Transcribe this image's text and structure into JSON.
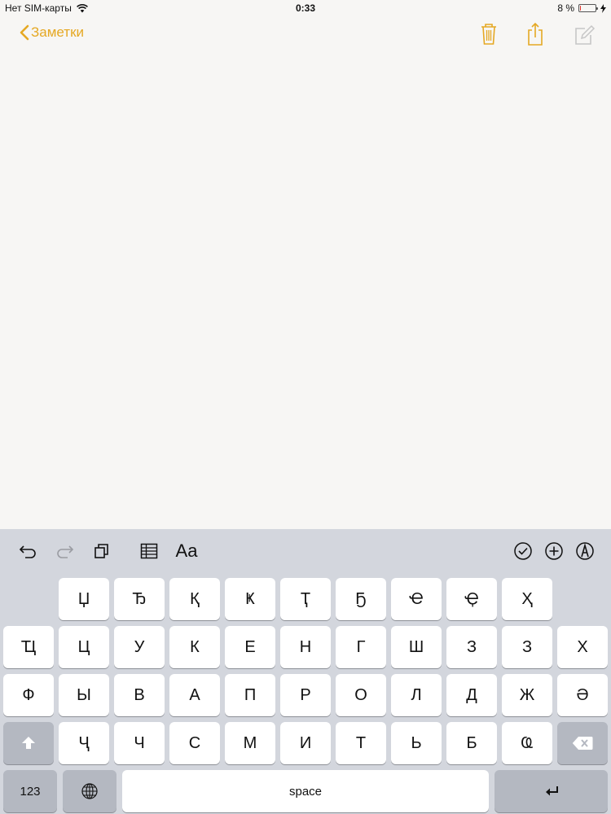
{
  "status_bar": {
    "carrier": "Нет SIM-карты",
    "time": "0:33",
    "battery_text": "8 %",
    "battery_level": 0.08
  },
  "nav": {
    "back_label": "Заметки",
    "accent_color": "#e5a823",
    "icons": [
      "trash-icon",
      "share-icon",
      "compose-icon"
    ]
  },
  "toolbar": {
    "format_label": "Aa",
    "icons": [
      "undo-icon",
      "redo-icon",
      "paste-icon",
      "table-icon",
      "checklist-icon",
      "add-icon",
      "markup-icon"
    ]
  },
  "keyboard": {
    "row1": [
      "Џ",
      "Ђ",
      "Қ",
      "Ҝ",
      "Ҭ",
      "Ҕ",
      "Ҽ",
      "Ҿ",
      "Ҳ"
    ],
    "row2": [
      "Ҵ",
      "Ц",
      "У",
      "К",
      "Е",
      "Н",
      "Г",
      "Ш",
      "З",
      "З",
      "Х"
    ],
    "row3": [
      "Ф",
      "Ы",
      "В",
      "А",
      "П",
      "Р",
      "О",
      "Л",
      "Д",
      "Ж",
      "Ә"
    ],
    "row4": [
      "Ҷ",
      "Ч",
      "С",
      "М",
      "И",
      "Т",
      "Ь",
      "Б",
      "Ҩ"
    ],
    "numbers_label": "123",
    "space_label": "space"
  }
}
